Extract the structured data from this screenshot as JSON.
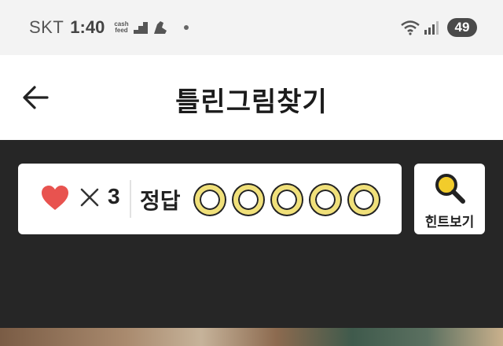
{
  "status_bar": {
    "carrier": "SKT",
    "time": "1:40",
    "cashfeed_line1": "cash",
    "cashfeed_line2": "feed",
    "battery": "49"
  },
  "header": {
    "title": "틀린그림찾기"
  },
  "game": {
    "lives_count": "3",
    "answer_label": "정답",
    "answer_slots": 5,
    "hint_label": "힌트보기"
  },
  "colors": {
    "heart": "#e8534f",
    "slot_ring": "#f0e07a",
    "hint_lens": "#f2cc2b",
    "dark_bg": "#262626"
  },
  "icons": [
    "back-arrow-icon",
    "heart-icon",
    "times-icon",
    "magnifier-icon",
    "wifi-icon",
    "signal-icon"
  ]
}
